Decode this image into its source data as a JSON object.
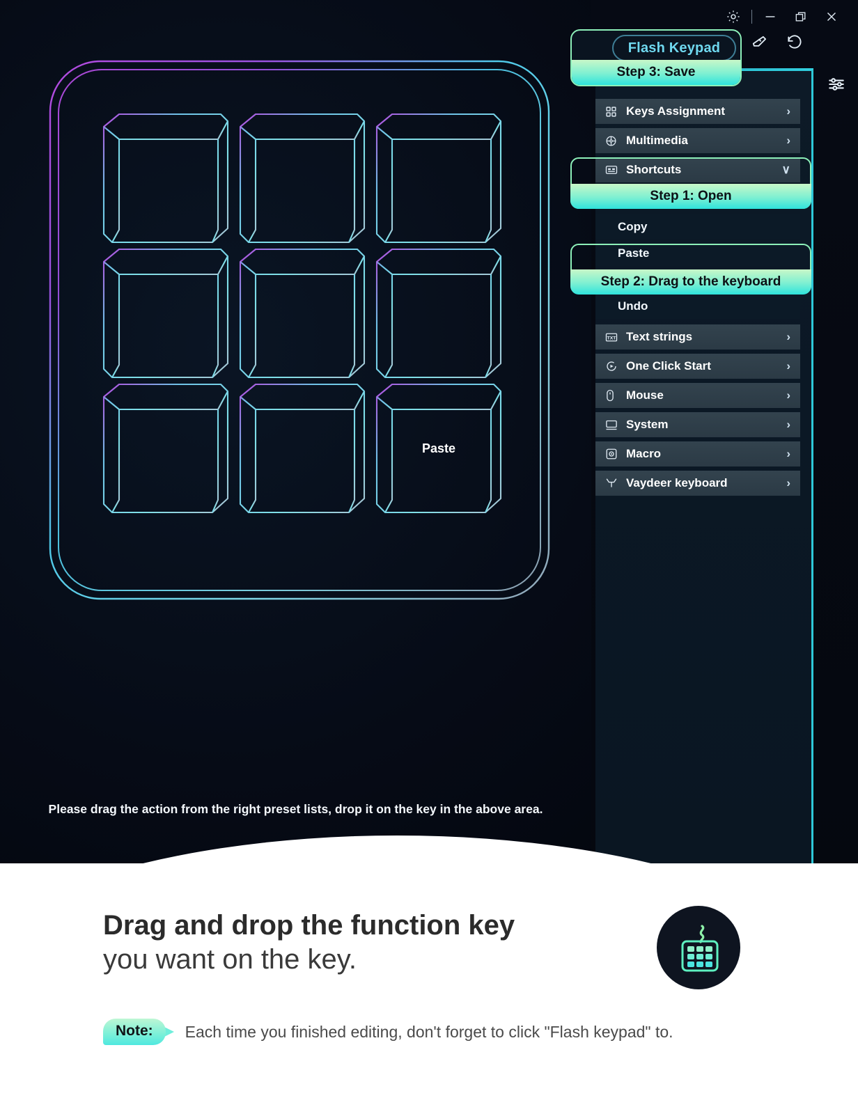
{
  "window": {
    "controls": [
      {
        "name": "settings",
        "glyph": "gear-icon"
      },
      {
        "name": "minimize",
        "glyph": "minimize-icon"
      },
      {
        "name": "maximize",
        "glyph": "maximize-icon"
      },
      {
        "name": "close",
        "glyph": "close-icon"
      }
    ]
  },
  "toolbar": {
    "flash_keypad_label": "Flash Keypad",
    "step3_label": "Step 3: Save",
    "eraser_icon": "eraser-icon",
    "reset_icon": "reset-icon",
    "sliders_icon": "sliders-icon"
  },
  "menu": {
    "items": [
      {
        "label": "Keys Assignment",
        "icon": "grid-icon",
        "chevron": "›",
        "expanded": false
      },
      {
        "label": "Multimedia",
        "icon": "film-reel-icon",
        "chevron": "›",
        "expanded": false
      },
      {
        "label": "Shortcuts",
        "icon": "keyboard-layout-icon",
        "chevron": "∨",
        "expanded": true
      },
      {
        "label": "Text strings",
        "icon": "text-icon",
        "chevron": "›",
        "expanded": false
      },
      {
        "label": "One Click Start",
        "icon": "play-circle-icon",
        "chevron": "›",
        "expanded": false
      },
      {
        "label": "Mouse",
        "icon": "mouse-icon",
        "chevron": "›",
        "expanded": false
      },
      {
        "label": "System",
        "icon": "monitor-icon",
        "chevron": "›",
        "expanded": false
      },
      {
        "label": "Macro",
        "icon": "macro-icon",
        "chevron": "›",
        "expanded": false
      },
      {
        "label": "Vaydeer keyboard",
        "icon": "vaydeer-logo-icon",
        "chevron": "›",
        "expanded": false
      }
    ],
    "shortcuts_sub_items": [
      {
        "label": "",
        "state": "dragging-ghost"
      },
      {
        "label": "Copy",
        "state": "normal"
      },
      {
        "label": "Paste",
        "state": "highlighted"
      },
      {
        "label": "Undo",
        "state": "normal"
      }
    ]
  },
  "steps": {
    "step1_label": "Step 1: Open",
    "step2_label": "Step 2: Drag  to the keyboard",
    "step3_label": "Step 3: Save"
  },
  "keypad": {
    "keys": [
      {
        "row": 0,
        "col": 0,
        "label": ""
      },
      {
        "row": 0,
        "col": 1,
        "label": ""
      },
      {
        "row": 0,
        "col": 2,
        "label": ""
      },
      {
        "row": 1,
        "col": 0,
        "label": ""
      },
      {
        "row": 1,
        "col": 1,
        "label": ""
      },
      {
        "row": 1,
        "col": 2,
        "label": ""
      },
      {
        "row": 2,
        "col": 0,
        "label": ""
      },
      {
        "row": 2,
        "col": 1,
        "label": ""
      },
      {
        "row": 2,
        "col": 2,
        "label": "Paste"
      }
    ],
    "hint": "Please drag the action from the right preset lists, drop it on the key in the above area."
  },
  "promo": {
    "headline_bold": "Drag and drop the function key",
    "headline_light": "you want on the key.",
    "badge_icon": "keypad-icon",
    "note_label": "Note:",
    "note_text": "Each time you finished editing, don't forget to click \"Flash keypad\" to."
  },
  "colors": {
    "accent_mint": "#8df0b9",
    "accent_cyan": "#2fe3dc",
    "pill_text": "#6fd8ef",
    "panel_dark": "#0c1a27",
    "menu_row": "#2f3e49"
  }
}
